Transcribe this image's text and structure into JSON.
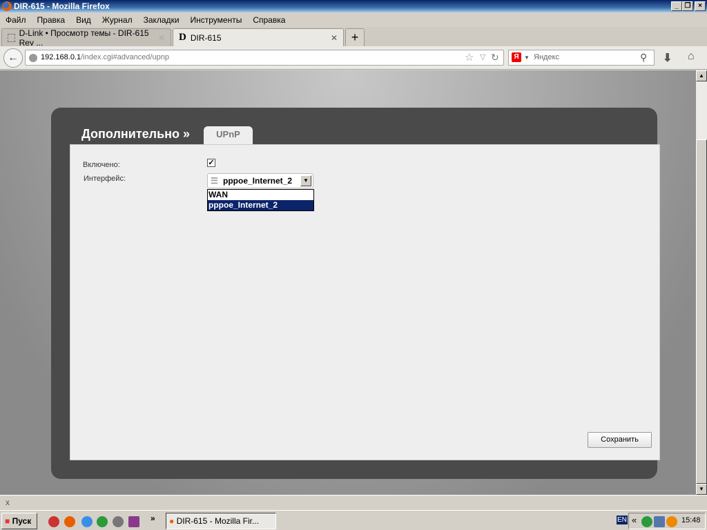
{
  "window": {
    "title": "DIR-615 - Mozilla Firefox"
  },
  "menu": [
    "Файл",
    "Правка",
    "Вид",
    "Журнал",
    "Закладки",
    "Инструменты",
    "Справка"
  ],
  "tabs": [
    {
      "label": "D-Link • Просмотр темы - DIR-615 Rev ..."
    },
    {
      "label": "DIR-615"
    }
  ],
  "nav": {
    "url_host": "192.168.0.1",
    "url_path": "/index.cgi#advanced/upnp",
    "search_placeholder": "Яндекс"
  },
  "page": {
    "breadcrumb": "Дополнительно »",
    "tab": "UPnP",
    "enabled_label": "Включено:",
    "enabled": true,
    "interface_label": "Интерфейс:",
    "interface_value": "pppoe_Internet_2",
    "interface_options": [
      "WAN",
      "pppoe_Internet_2"
    ],
    "save_label": "Сохранить"
  },
  "findbar": {
    "close": "x"
  },
  "taskbar": {
    "start": "Пуск",
    "more": "»",
    "window_btn": "DIR-615 - Mozilla Fir...",
    "lang": "EN",
    "tray_more": "«",
    "clock": "15:48"
  }
}
